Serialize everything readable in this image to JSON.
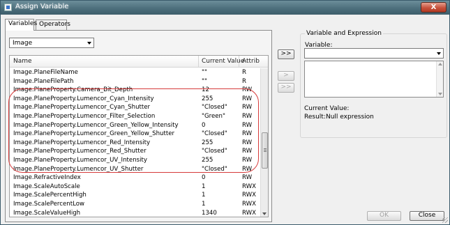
{
  "window": {
    "title": "Assign Variable",
    "close_glyph": "X"
  },
  "tabs": [
    {
      "label": "Variables",
      "active": true
    },
    {
      "label": "Operators",
      "active": false
    }
  ],
  "category": {
    "selected": "Image"
  },
  "table": {
    "columns": [
      "Name",
      "Current Value",
      "Attrib"
    ],
    "rows": [
      {
        "name": "Image.PlaneFileName",
        "value": "\"\"",
        "attr": "R"
      },
      {
        "name": "Image.PlaneFilePath",
        "value": "\"\"",
        "attr": "R"
      },
      {
        "name": "Image.PlaneProperty.Camera_Bit_Depth",
        "value": "12",
        "attr": "RW"
      },
      {
        "name": "Image.PlaneProperty.Lumencor_Cyan_Intensity",
        "value": "255",
        "attr": "RW"
      },
      {
        "name": "Image.PlaneProperty.Lumencor_Cyan_Shutter",
        "value": "\"Closed\"",
        "attr": "RW"
      },
      {
        "name": "Image.PlaneProperty.Lumencor_Filter_Selection",
        "value": "\"Green\"",
        "attr": "RW"
      },
      {
        "name": "Image.PlaneProperty.Lumencor_Green_Yellow_Intensity",
        "value": "0",
        "attr": "RW"
      },
      {
        "name": "Image.PlaneProperty.Lumencor_Green_Yellow_Shutter",
        "value": "\"Closed\"",
        "attr": "RW"
      },
      {
        "name": "Image.PlaneProperty.Lumencor_Red_Intensity",
        "value": "255",
        "attr": "RW"
      },
      {
        "name": "Image.PlaneProperty.Lumencor_Red_Shutter",
        "value": "\"Closed\"",
        "attr": "RW"
      },
      {
        "name": "Image.PlaneProperty.Lumencor_UV_Intensity",
        "value": "255",
        "attr": "RW"
      },
      {
        "name": "Image.PlaneProperty.Lumencor_UV_Shutter",
        "value": "\"Closed\"",
        "attr": "RW"
      },
      {
        "name": "Image.RefractiveIndex",
        "value": "0",
        "attr": "RW"
      },
      {
        "name": "Image.ScaleAutoScale",
        "value": "1",
        "attr": "RWX"
      },
      {
        "name": "Image.ScalePercentHigh",
        "value": "1",
        "attr": "RWX"
      },
      {
        "name": "Image.ScalePercentLow",
        "value": "1",
        "attr": "RWX"
      },
      {
        "name": "Image.ScaleValueHigh",
        "value": "1340",
        "attr": "RWX"
      }
    ]
  },
  "buttons": {
    "insert": ">>",
    "next": ">",
    "last": ">>",
    "ok": "OK",
    "close": "Close"
  },
  "expression_panel": {
    "group_title": "Variable and Expression",
    "variable_label": "Variable:",
    "variable_value": "",
    "current_value_label": "Current Value:",
    "result_label": "Result:",
    "result_value": "Null expression"
  },
  "colors": {
    "highlight_ring": "#d63a3a",
    "titlebar": "#4d6f7c"
  }
}
